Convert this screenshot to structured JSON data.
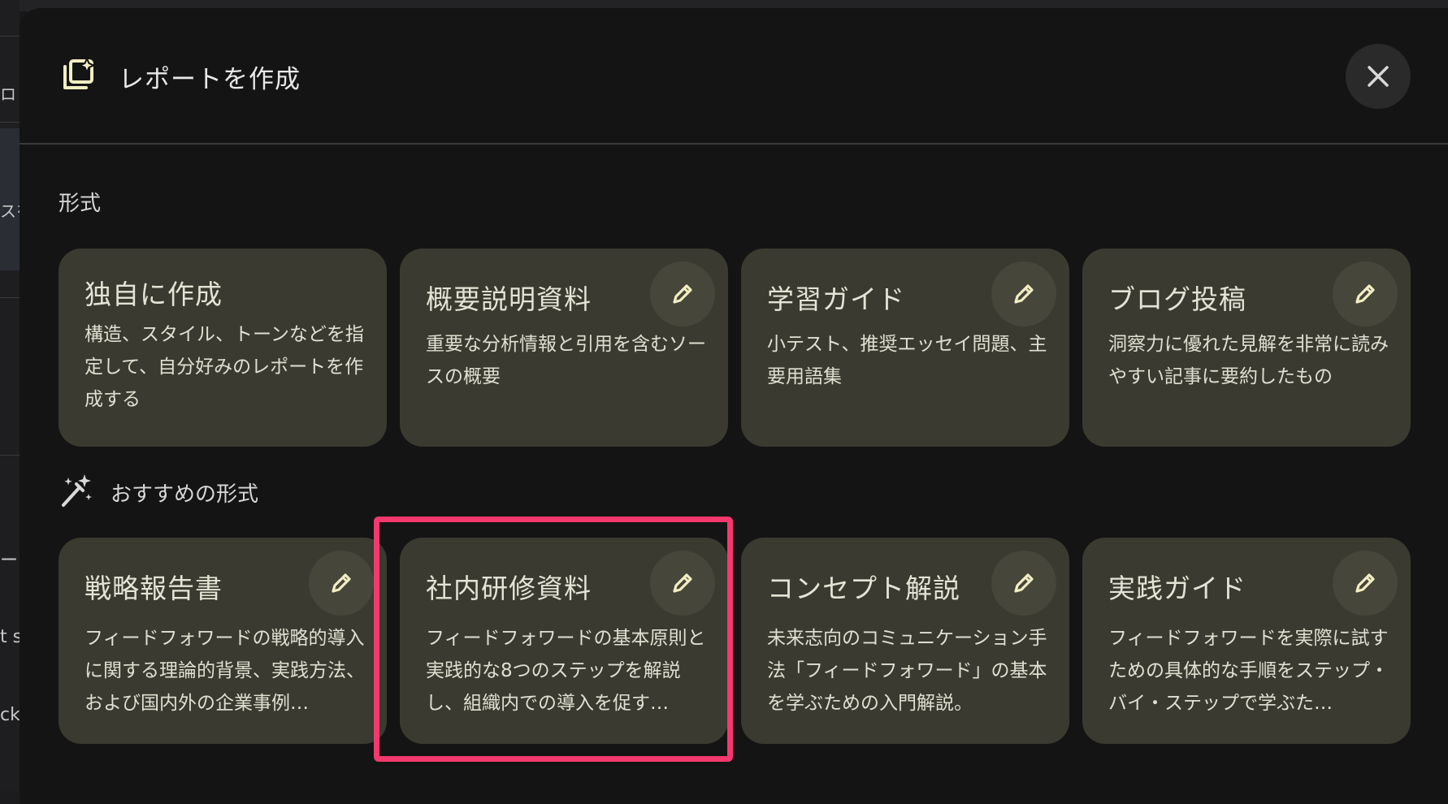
{
  "background": {
    "left_fragments": [
      "ロ",
      "スを",
      "ート",
      "t s",
      "ck"
    ]
  },
  "dialog": {
    "title": "レポートを作成",
    "close_icon": "close-icon",
    "header_icon": "report-sparkle-icon"
  },
  "format_section": {
    "label": "形式",
    "cards": [
      {
        "title": "独自に作成",
        "description": "構造、スタイル、トーンなどを指定して、自分好みのレポートを作成する",
        "editable": false
      },
      {
        "title": "概要説明資料",
        "description": "重要な分析情報と引用を含むソースの概要",
        "editable": true
      },
      {
        "title": "学習ガイド",
        "description": "小テスト、推奨エッセイ問題、主要用語集",
        "editable": true
      },
      {
        "title": "ブログ投稿",
        "description": "洞察力に優れた見解を非常に読みやすい記事に要約したもの",
        "editable": true
      }
    ]
  },
  "recommended_section": {
    "label": "おすすめの形式",
    "icon": "magic-wand-icon",
    "cards": [
      {
        "title": "戦略報告書",
        "description": "フィードフォワードの戦略的導入に関する理論的背景、実践方法、および国内外の企業事例…",
        "editable": true
      },
      {
        "title": "社内研修資料",
        "description": "フィードフォワードの基本原則と実践的な8つのステップを解説し、組織内での導入を促す…",
        "editable": true,
        "highlighted": true
      },
      {
        "title": "コンセプト解説",
        "description": "未来志向のコミュニケーション手法「フィードフォワード」の基本を学ぶための入門解説。",
        "editable": true
      },
      {
        "title": "実践ガイド",
        "description": "フィードフォワードを実際に試すための具体的な手順をステップ・バイ・ステップで学ぶた…",
        "editable": true
      }
    ]
  },
  "colors": {
    "card_bg": "#3a3a30",
    "dialog_bg": "#141414",
    "highlight": "#f5386e",
    "accent_icon": "#f3eec2"
  }
}
